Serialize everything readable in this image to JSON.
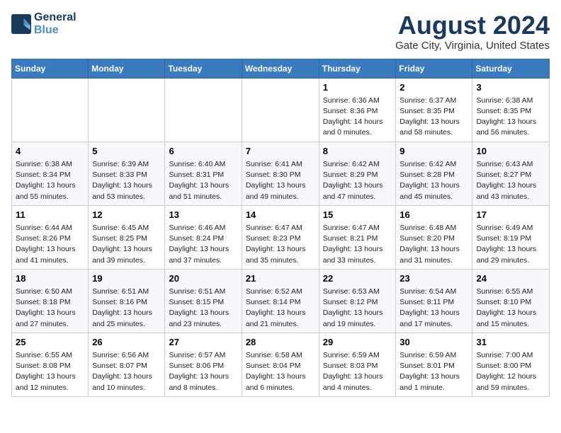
{
  "header": {
    "logo_line1": "General",
    "logo_line2": "Blue",
    "month_title": "August 2024",
    "location": "Gate City, Virginia, United States"
  },
  "weekdays": [
    "Sunday",
    "Monday",
    "Tuesday",
    "Wednesday",
    "Thursday",
    "Friday",
    "Saturday"
  ],
  "weeks": [
    [
      {
        "day": "",
        "info": ""
      },
      {
        "day": "",
        "info": ""
      },
      {
        "day": "",
        "info": ""
      },
      {
        "day": "",
        "info": ""
      },
      {
        "day": "1",
        "info": "Sunrise: 6:36 AM\nSunset: 8:36 PM\nDaylight: 14 hours\nand 0 minutes."
      },
      {
        "day": "2",
        "info": "Sunrise: 6:37 AM\nSunset: 8:35 PM\nDaylight: 13 hours\nand 58 minutes."
      },
      {
        "day": "3",
        "info": "Sunrise: 6:38 AM\nSunset: 8:35 PM\nDaylight: 13 hours\nand 56 minutes."
      }
    ],
    [
      {
        "day": "4",
        "info": "Sunrise: 6:38 AM\nSunset: 8:34 PM\nDaylight: 13 hours\nand 55 minutes."
      },
      {
        "day": "5",
        "info": "Sunrise: 6:39 AM\nSunset: 8:33 PM\nDaylight: 13 hours\nand 53 minutes."
      },
      {
        "day": "6",
        "info": "Sunrise: 6:40 AM\nSunset: 8:31 PM\nDaylight: 13 hours\nand 51 minutes."
      },
      {
        "day": "7",
        "info": "Sunrise: 6:41 AM\nSunset: 8:30 PM\nDaylight: 13 hours\nand 49 minutes."
      },
      {
        "day": "8",
        "info": "Sunrise: 6:42 AM\nSunset: 8:29 PM\nDaylight: 13 hours\nand 47 minutes."
      },
      {
        "day": "9",
        "info": "Sunrise: 6:42 AM\nSunset: 8:28 PM\nDaylight: 13 hours\nand 45 minutes."
      },
      {
        "day": "10",
        "info": "Sunrise: 6:43 AM\nSunset: 8:27 PM\nDaylight: 13 hours\nand 43 minutes."
      }
    ],
    [
      {
        "day": "11",
        "info": "Sunrise: 6:44 AM\nSunset: 8:26 PM\nDaylight: 13 hours\nand 41 minutes."
      },
      {
        "day": "12",
        "info": "Sunrise: 6:45 AM\nSunset: 8:25 PM\nDaylight: 13 hours\nand 39 minutes."
      },
      {
        "day": "13",
        "info": "Sunrise: 6:46 AM\nSunset: 8:24 PM\nDaylight: 13 hours\nand 37 minutes."
      },
      {
        "day": "14",
        "info": "Sunrise: 6:47 AM\nSunset: 8:23 PM\nDaylight: 13 hours\nand 35 minutes."
      },
      {
        "day": "15",
        "info": "Sunrise: 6:47 AM\nSunset: 8:21 PM\nDaylight: 13 hours\nand 33 minutes."
      },
      {
        "day": "16",
        "info": "Sunrise: 6:48 AM\nSunset: 8:20 PM\nDaylight: 13 hours\nand 31 minutes."
      },
      {
        "day": "17",
        "info": "Sunrise: 6:49 AM\nSunset: 8:19 PM\nDaylight: 13 hours\nand 29 minutes."
      }
    ],
    [
      {
        "day": "18",
        "info": "Sunrise: 6:50 AM\nSunset: 8:18 PM\nDaylight: 13 hours\nand 27 minutes."
      },
      {
        "day": "19",
        "info": "Sunrise: 6:51 AM\nSunset: 8:16 PM\nDaylight: 13 hours\nand 25 minutes."
      },
      {
        "day": "20",
        "info": "Sunrise: 6:51 AM\nSunset: 8:15 PM\nDaylight: 13 hours\nand 23 minutes."
      },
      {
        "day": "21",
        "info": "Sunrise: 6:52 AM\nSunset: 8:14 PM\nDaylight: 13 hours\nand 21 minutes."
      },
      {
        "day": "22",
        "info": "Sunrise: 6:53 AM\nSunset: 8:12 PM\nDaylight: 13 hours\nand 19 minutes."
      },
      {
        "day": "23",
        "info": "Sunrise: 6:54 AM\nSunset: 8:11 PM\nDaylight: 13 hours\nand 17 minutes."
      },
      {
        "day": "24",
        "info": "Sunrise: 6:55 AM\nSunset: 8:10 PM\nDaylight: 13 hours\nand 15 minutes."
      }
    ],
    [
      {
        "day": "25",
        "info": "Sunrise: 6:55 AM\nSunset: 8:08 PM\nDaylight: 13 hours\nand 12 minutes."
      },
      {
        "day": "26",
        "info": "Sunrise: 6:56 AM\nSunset: 8:07 PM\nDaylight: 13 hours\nand 10 minutes."
      },
      {
        "day": "27",
        "info": "Sunrise: 6:57 AM\nSunset: 8:06 PM\nDaylight: 13 hours\nand 8 minutes."
      },
      {
        "day": "28",
        "info": "Sunrise: 6:58 AM\nSunset: 8:04 PM\nDaylight: 13 hours\nand 6 minutes."
      },
      {
        "day": "29",
        "info": "Sunrise: 6:59 AM\nSunset: 8:03 PM\nDaylight: 13 hours\nand 4 minutes."
      },
      {
        "day": "30",
        "info": "Sunrise: 6:59 AM\nSunset: 8:01 PM\nDaylight: 13 hours\nand 1 minute."
      },
      {
        "day": "31",
        "info": "Sunrise: 7:00 AM\nSunset: 8:00 PM\nDaylight: 12 hours\nand 59 minutes."
      }
    ]
  ]
}
